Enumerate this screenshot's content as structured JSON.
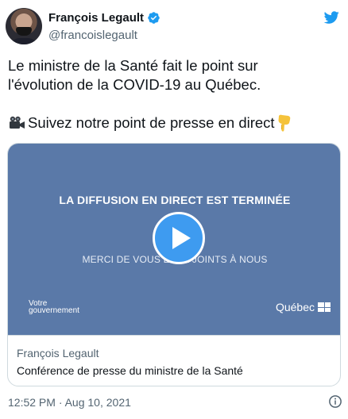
{
  "author": {
    "name": "François Legault",
    "handle": "@francoislegault",
    "verified": true
  },
  "icons": {
    "brand": "twitter-bird-icon",
    "verified": "verified-badge-icon",
    "camera": "movie-camera-emoji",
    "pointing": "pointing-down-emoji",
    "info": "info-icon"
  },
  "tweet": {
    "line1": "Le ministre de la Santé fait le point sur",
    "line2": "l'évolution de la COVID-19 au Québec.",
    "cta": "Suivez notre point de presse en direct"
  },
  "card": {
    "video_banner": "LA DIFFUSION EN DIRECT EST TERMINÉE",
    "video_subtitle": "MERCI DE VOUS ÊTRE JOINTS À NOUS",
    "gov_line1": "Votre",
    "gov_line2": "gouvernement",
    "brand": "Québec",
    "site": "François Legault",
    "title": "Conférence de presse du ministre de la Santé"
  },
  "footer": {
    "timestamp": "12:52 PM · Aug 10, 2021"
  },
  "colors": {
    "twitter_blue": "#1d9bf0",
    "video_bg": "#5a79a8",
    "play_button": "#3e9bf0",
    "secondary_text": "#536471"
  }
}
